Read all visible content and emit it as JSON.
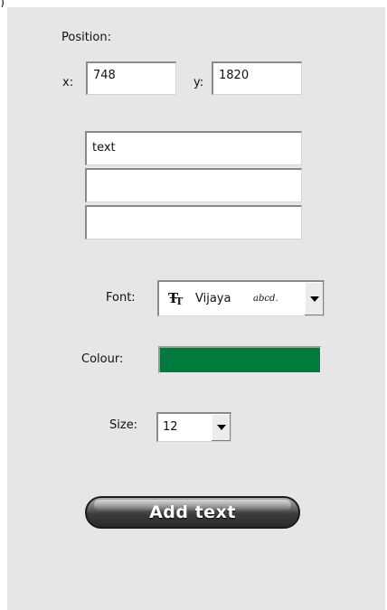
{
  "corner_mark": ")",
  "position": {
    "label": "Position:",
    "x_label": "x:",
    "x_value": "748",
    "y_label": "y:",
    "y_value": "1820"
  },
  "text_lines": [
    "text",
    "",
    ""
  ],
  "font": {
    "label": "Font:",
    "icon": "truetype-icon",
    "name": "Vijaya",
    "sample": "abcd."
  },
  "colour": {
    "label": "Colour:",
    "value": "#007a3d"
  },
  "size": {
    "label": "Size:",
    "value": "12"
  },
  "add_button_label": "Add text"
}
